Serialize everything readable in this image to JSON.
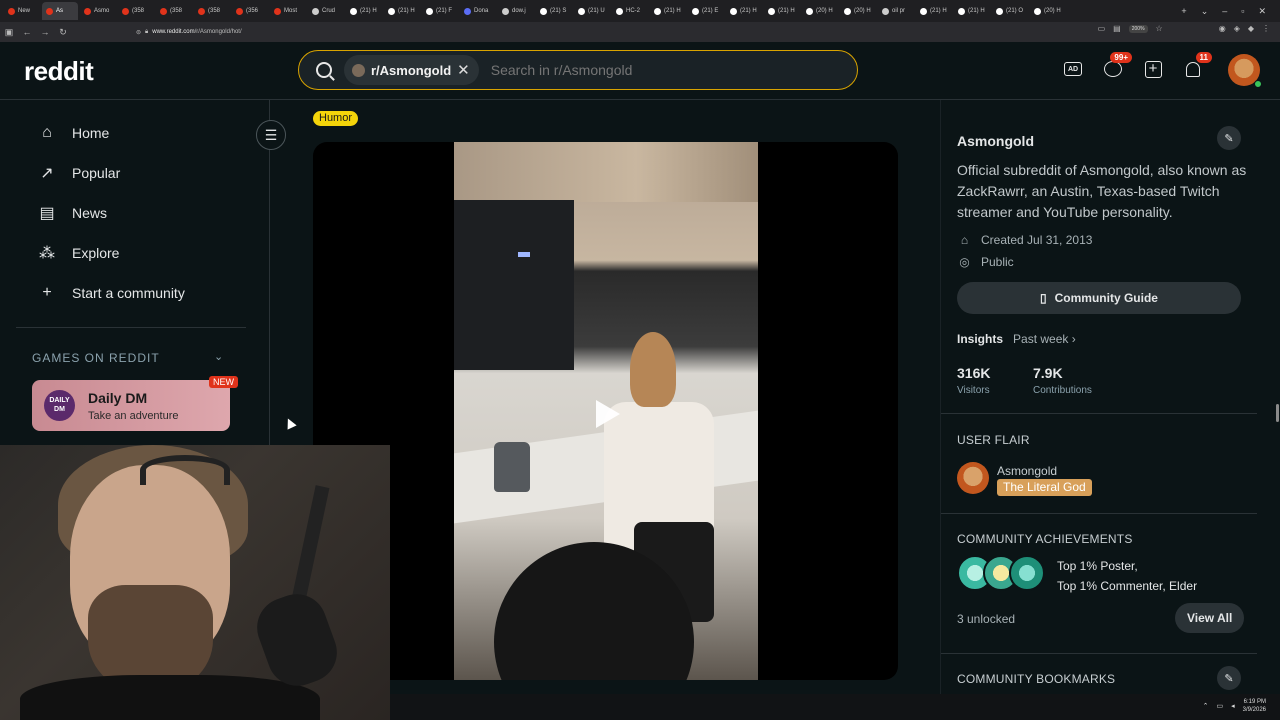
{
  "browser": {
    "tabs": [
      {
        "label": "New",
        "color": "#e0331b"
      },
      {
        "label": "As",
        "color": "#e0331b",
        "active": true
      },
      {
        "label": "Asmo",
        "color": "#e0331b"
      },
      {
        "label": "(358",
        "color": "#e0331b"
      },
      {
        "label": "(358",
        "color": "#e0331b"
      },
      {
        "label": "(358",
        "color": "#e0331b"
      },
      {
        "label": "(356",
        "color": "#e0331b"
      },
      {
        "label": "Most",
        "color": "#e0331b"
      },
      {
        "label": "Crud",
        "color": "#cccccc"
      },
      {
        "label": "(21) H",
        "color": "#ffffff"
      },
      {
        "label": "(21) H",
        "color": "#ffffff"
      },
      {
        "label": "(21) F",
        "color": "#ffffff"
      },
      {
        "label": "Dona",
        "color": "#5b6df5"
      },
      {
        "label": "dow.j",
        "color": "#cccccc"
      },
      {
        "label": "(21) S",
        "color": "#ffffff"
      },
      {
        "label": "(21) U",
        "color": "#ffffff"
      },
      {
        "label": "HC-2",
        "color": "#ffffff"
      },
      {
        "label": "(21) H",
        "color": "#ffffff"
      },
      {
        "label": "(21) E",
        "color": "#ffffff"
      },
      {
        "label": "(21) H",
        "color": "#ffffff"
      },
      {
        "label": "(21) H",
        "color": "#ffffff"
      },
      {
        "label": "(20) H",
        "color": "#ffffff"
      },
      {
        "label": "(20) H",
        "color": "#ffffff"
      },
      {
        "label": "oil pr",
        "color": "#cccccc"
      },
      {
        "label": "(21) H",
        "color": "#ffffff"
      },
      {
        "label": "(21) H",
        "color": "#ffffff"
      },
      {
        "label": "(21) O",
        "color": "#ffffff"
      },
      {
        "label": "(20) H",
        "color": "#ffffff"
      }
    ],
    "url_host": "www.reddit.com",
    "url_path": "/r/Asmongold/hot/",
    "zoom": "200%"
  },
  "header": {
    "logo": "reddit",
    "search_chip": "r/Asmongold",
    "search_placeholder": "Search in r/Asmongold",
    "chat_badge": "99+",
    "notif_badge": "11"
  },
  "sidebar": {
    "items": [
      {
        "label": "Home",
        "icon": "home-icon",
        "glyph": "⌂"
      },
      {
        "label": "Popular",
        "icon": "popular-icon",
        "glyph": "↗"
      },
      {
        "label": "News",
        "icon": "news-icon",
        "glyph": "▤"
      },
      {
        "label": "Explore",
        "icon": "explore-icon",
        "glyph": "⁂"
      },
      {
        "label": "Start a community",
        "icon": "plus-icon",
        "glyph": "+"
      }
    ],
    "games_heading": "GAMES ON REDDIT",
    "game": {
      "logo": "DAILY DM",
      "title": "Daily DM",
      "subtitle": "Take an adventure",
      "tag": "NEW"
    }
  },
  "post": {
    "flair": "Humor"
  },
  "community": {
    "name": "Asmongold",
    "description": "Official subreddit of Asmongold, also known as ZackRawrr, an Austin, Texas-based Twitch streamer and YouTube personality.",
    "created": "Created Jul 31, 2013",
    "visibility": "Public",
    "guide_button": "Community Guide",
    "insights_label": "Insights",
    "insights_period": "Past week",
    "visitors_value": "316K",
    "visitors_label": "Visitors",
    "contrib_value": "7.9K",
    "contrib_label": "Contributions",
    "user_flair_heading": "USER FLAIR",
    "user_name": "Asmongold",
    "user_flair": "The Literal God",
    "achievements_heading": "COMMUNITY ACHIEVEMENTS",
    "achievements_line1": "Top 1% Poster,",
    "achievements_line2": "Top 1% Commenter, Elder",
    "unlocked": "3 unlocked",
    "view_all": "View All",
    "bookmarks_heading": "COMMUNITY BOOKMARKS"
  },
  "taskbar": {
    "time": "6:19 PM",
    "date": "3/9/2026"
  },
  "colors": {
    "accent": "#d9a400",
    "badge": "#e0331b",
    "flair_humor": "#f4d40a",
    "user_flair": "#d8a05a"
  }
}
